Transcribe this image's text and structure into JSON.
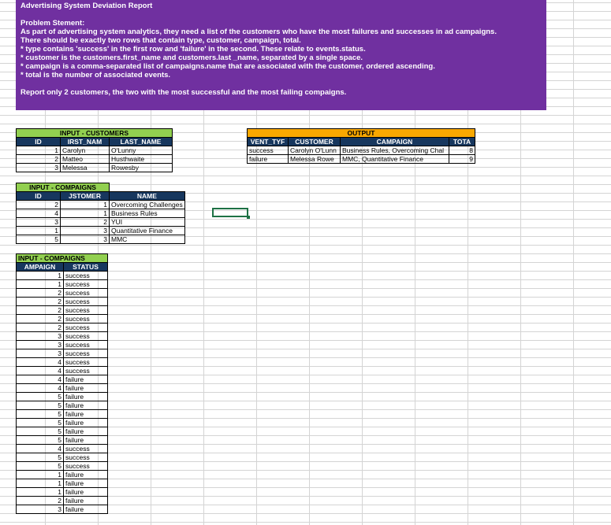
{
  "header": {
    "title": "Advertising System Deviation Report",
    "lines": [
      "Problem Stement:",
      "As part of  advertising system analytics, they need a list of the customers who have the most failures and successes in ad campaigns.",
      "There should be exactly two rows that contain type, customer, campaign, total.",
      "* type contains 'success' in the first row and 'failure' in the second. These relate to events.status.",
      "* customer is the customers.first_name and customers.last _name, separated by a single space.",
      "* campaign is a comma-separated list of campaigns.name that are associated with the customer, ordered ascending.",
      "* total is the number of associated events.",
      "",
      "Report only 2 customers, the two with the most successful and the most failing compaigns."
    ]
  },
  "customers": {
    "title": "INPUT - CUSTOMERS",
    "headers": [
      "ID",
      "IRST_NAM",
      "LAST_NAME"
    ],
    "rows": [
      [
        "1",
        "Carolyn",
        "O'Lunny"
      ],
      [
        "2",
        "Matteo",
        "Husthwaite"
      ],
      [
        "3",
        "Melessa",
        "Rowesby"
      ]
    ]
  },
  "campaigns": {
    "title": "INPUT - COMPAIGNS",
    "headers": [
      "ID",
      "JSTOMER",
      "NAME"
    ],
    "rows": [
      [
        "2",
        "1",
        "Overcoming Challenges"
      ],
      [
        "4",
        "1",
        "Business Rules"
      ],
      [
        "3",
        "2",
        "YUI"
      ],
      [
        "1",
        "3",
        "Quantitative Finance"
      ],
      [
        "5",
        "3",
        "MMC"
      ]
    ]
  },
  "events": {
    "title": "INPUT - COMPAIGNS",
    "headers": [
      "AMPAIGN",
      "STATUS"
    ],
    "rows": [
      [
        "1",
        "success"
      ],
      [
        "1",
        "success"
      ],
      [
        "2",
        "success"
      ],
      [
        "2",
        "success"
      ],
      [
        "2",
        "success"
      ],
      [
        "2",
        "success"
      ],
      [
        "2",
        "success"
      ],
      [
        "3",
        "success"
      ],
      [
        "3",
        "success"
      ],
      [
        "3",
        "success"
      ],
      [
        "4",
        "success"
      ],
      [
        "4",
        "success"
      ],
      [
        "4",
        "failure"
      ],
      [
        "4",
        "failure"
      ],
      [
        "5",
        "failure"
      ],
      [
        "5",
        "failure"
      ],
      [
        "5",
        "failure"
      ],
      [
        "5",
        "failure"
      ],
      [
        "5",
        "failure"
      ],
      [
        "5",
        "failure"
      ],
      [
        "4",
        "success"
      ],
      [
        "5",
        "success"
      ],
      [
        "5",
        "success"
      ],
      [
        "1",
        "failure"
      ],
      [
        "1",
        "failure"
      ],
      [
        "1",
        "failure"
      ],
      [
        "2",
        "failure"
      ],
      [
        "3",
        "failure"
      ]
    ]
  },
  "output": {
    "title": "OUTPUT",
    "headers": [
      "VENT_TYF",
      "CUSTOMER",
      "CAMPAIGN",
      "TOTA"
    ],
    "rows": [
      [
        "success",
        "Carolyn O'Lunn",
        "Business Rules, Overcoming Chal",
        "8"
      ],
      [
        "failure",
        "Melessa Rowe",
        "MMC, Quantitative Finance",
        "9"
      ]
    ]
  }
}
